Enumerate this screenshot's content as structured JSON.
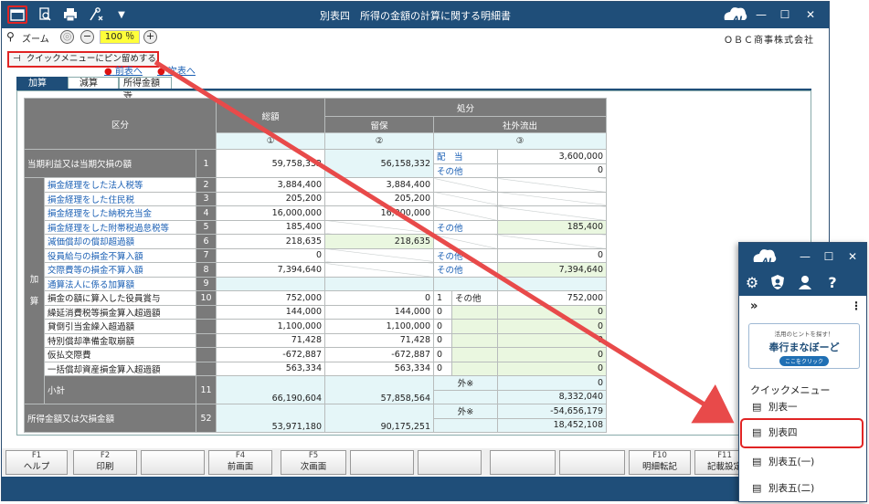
{
  "window": {
    "title": "別表四　所得の金額の計算に関する明細書",
    "company": "ＯＢＣ商事株式会社",
    "logo_text": "AI"
  },
  "zoom": {
    "label": "ズーム",
    "value": "100",
    "unit": "％"
  },
  "popup": {
    "pin_label": "クイックメニューにピン留めする"
  },
  "nav": {
    "link1": "前表へ",
    "link2": "次表へ"
  },
  "tabs": [
    "加算",
    "減算",
    "所得金額等"
  ],
  "table": {
    "headers": {
      "kubun": "区分",
      "sougaku": "総額",
      "shobun": "処分",
      "ryuho": "留保",
      "shagai": "社外流出",
      "c1": "①",
      "c2": "②",
      "c3": "③"
    },
    "toki": {
      "label": "当期利益又は当期欠損の額",
      "no": "1",
      "total": "59,758,332",
      "ryuho": "56,158,332",
      "haito_label": "配　当",
      "haito_value": "3,600,000",
      "sonota_label": "その他",
      "sonota_value": "0"
    },
    "kasan_label_1": "加",
    "kasan_label_2": "算",
    "rows": [
      {
        "label": "損金経理をした法人税等",
        "no": "2",
        "total": "3,884,400",
        "ryuho": "3,884,400",
        "cat": "",
        "flag": "",
        "out": ""
      },
      {
        "label": "損金経理をした住民税",
        "no": "3",
        "total": "205,200",
        "ryuho": "205,200",
        "cat": "",
        "flag": "",
        "out": ""
      },
      {
        "label": "損金経理をした納税充当金",
        "no": "4",
        "total": "16,000,000",
        "ryuho": "16,000,000",
        "cat": "",
        "flag": "",
        "out": ""
      },
      {
        "label": "損金経理をした附帯税過怠税等",
        "no": "5",
        "total": "185,400",
        "ryuho": "",
        "cat": "その他",
        "flag": "",
        "out": "185,400"
      },
      {
        "label": "減価償却の償却超過額",
        "no": "6",
        "total": "218,635",
        "ryuho": "218,635",
        "cat": "",
        "flag": "",
        "out": ""
      },
      {
        "label": "役員給与の損金不算入額",
        "no": "7",
        "total": "0",
        "ryuho": "",
        "cat": "その他",
        "flag": "",
        "out": "0"
      },
      {
        "label": "交際費等の損金不算入額",
        "no": "8",
        "total": "7,394,640",
        "ryuho": "",
        "cat": "その他",
        "flag": "",
        "out": "7,394,640"
      },
      {
        "label": "通算法人に係る加算額",
        "no": "9",
        "total": "",
        "ryuho": "",
        "cat": "",
        "flag": "",
        "out": ""
      },
      {
        "label": "損金の額に算入した役員賞与",
        "no": "10",
        "total": "752,000",
        "ryuho": "0",
        "cat": "その他",
        "flag": "1",
        "out": "752,000"
      },
      {
        "label": "繰延消費税等損金算入超過額",
        "no": "",
        "total": "144,000",
        "ryuho": "144,000",
        "cat": "",
        "flag": "0",
        "out": "0"
      },
      {
        "label": "貸倒引当金繰入超過額",
        "no": "",
        "total": "1,100,000",
        "ryuho": "1,100,000",
        "cat": "",
        "flag": "0",
        "out": "0"
      },
      {
        "label": "特別償却準備金取崩額",
        "no": "",
        "total": "71,428",
        "ryuho": "71,428",
        "cat": "",
        "flag": "0",
        "out": "0"
      },
      {
        "label": "仮払交際費",
        "no": "",
        "total": "-672,887",
        "ryuho": "-672,887",
        "cat": "",
        "flag": "0",
        "out": "0"
      },
      {
        "label": "一括償却資産損金算入超過額",
        "no": "",
        "total": "563,334",
        "ryuho": "563,334",
        "cat": "",
        "flag": "0",
        "out": "0"
      }
    ],
    "subtotal": {
      "label": "小計",
      "no": "11",
      "total": "66,190,604",
      "ryuho": "57,858,564",
      "gai_label": "外※",
      "out_top": "0",
      "out_bottom": "8,332,040"
    },
    "shotoku": {
      "label": "所得金額又は欠損金額",
      "no": "52",
      "total": "53,971,180",
      "ryuho": "90,175,251",
      "gai_label": "外※",
      "out_top": "-54,656,179",
      "out_bottom": "18,452,108"
    }
  },
  "fkeys": [
    {
      "no": "F1",
      "label": "ヘルプ"
    },
    {
      "no": "F2",
      "label": "印刷"
    },
    {
      "no": "",
      "label": ""
    },
    {
      "no": "F4",
      "label": "前画面"
    },
    {
      "no": "F5",
      "label": "次画面"
    },
    {
      "no": "",
      "label": ""
    },
    {
      "no": "",
      "label": ""
    },
    {
      "no": "",
      "label": ""
    },
    {
      "no": "",
      "label": ""
    },
    {
      "no": "F10",
      "label": "明細転記"
    },
    {
      "no": "F11",
      "label": "記載設定"
    }
  ],
  "quick_panel": {
    "logo_text": "AI",
    "banner_top": "活用のヒントを探す！",
    "banner_main": "奉行まなぼーど",
    "banner_btn": "ここをクリック",
    "heading": "クイックメニュー",
    "items": [
      "別表一",
      "別表四",
      "別表五(一)",
      "別表五(二)"
    ],
    "highlighted": "別表四"
  },
  "colors": {
    "titlebar": "#1f4e79",
    "header_gray": "#7a7a7a",
    "highlight_red": "#e02424",
    "zoom_yellow": "#ffff3a",
    "cell_blue": "#e5f6f8",
    "cell_green": "#eaf7e0"
  }
}
